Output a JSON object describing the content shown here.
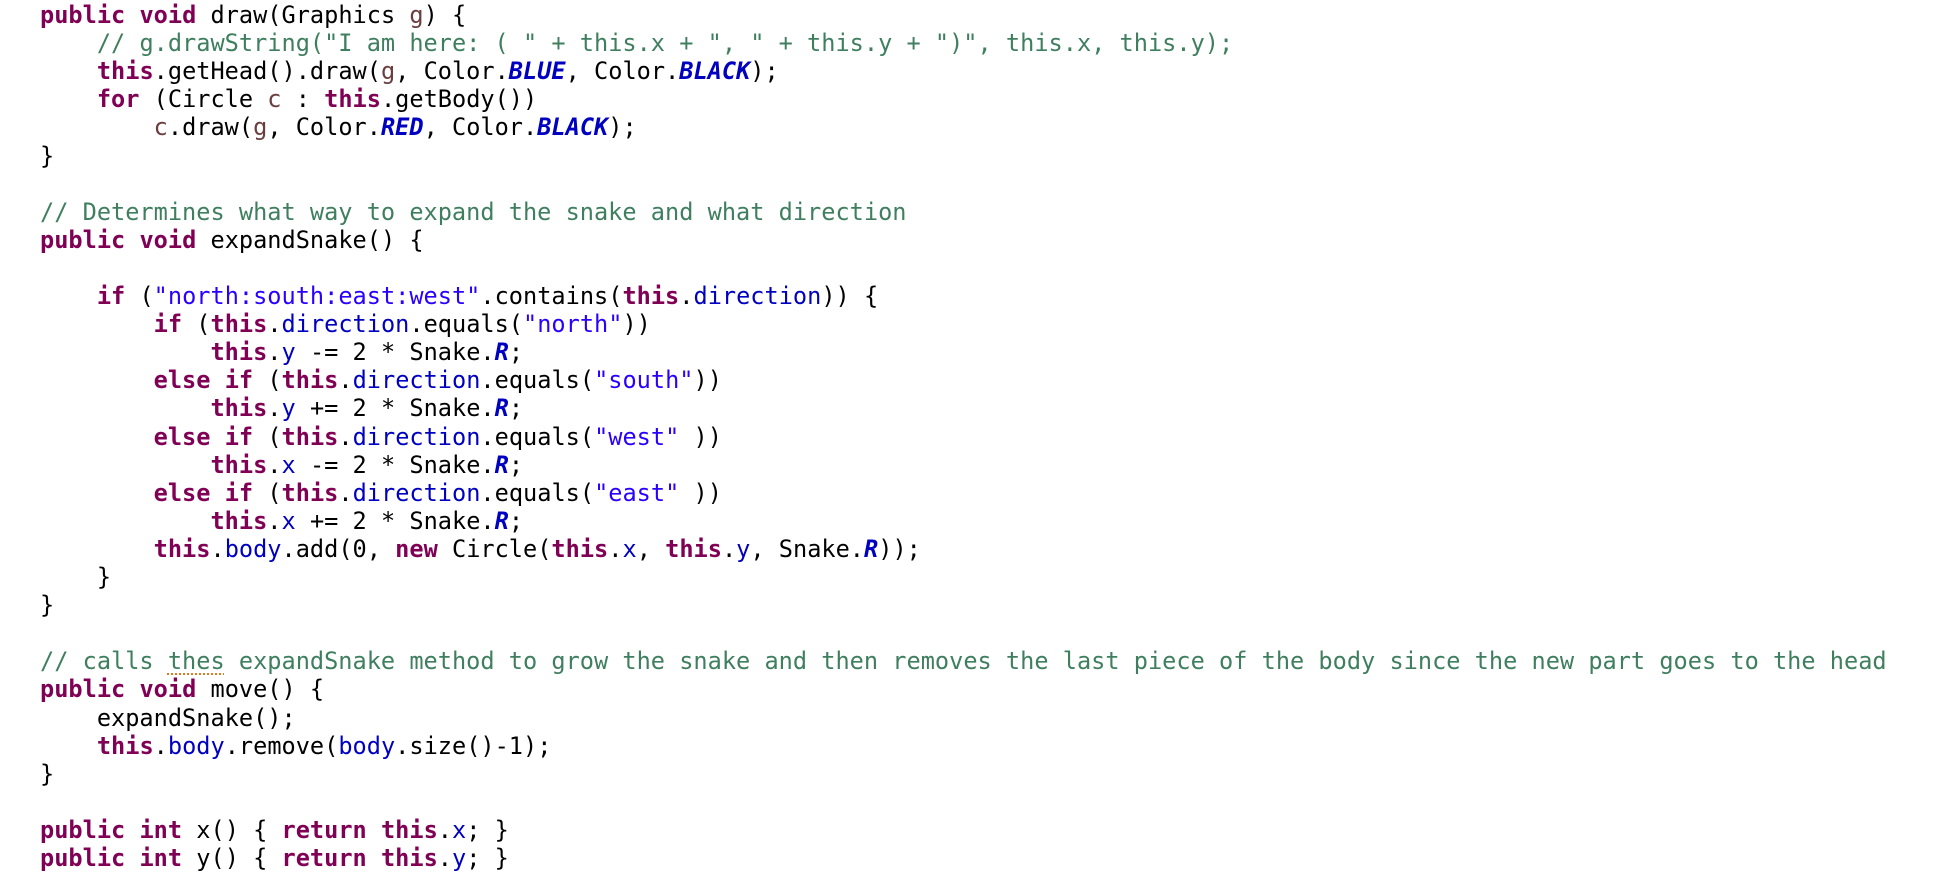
{
  "lines": [
    {
      "tokens": [
        {
          "t": "public",
          "k": "kw"
        },
        {
          "t": " ",
          "k": "pl"
        },
        {
          "t": "void",
          "k": "kw"
        },
        {
          "t": " draw(Graphics ",
          "k": "pl"
        },
        {
          "t": "g",
          "k": "lv"
        },
        {
          "t": ") {",
          "k": "pl"
        }
      ]
    },
    {
      "tokens": [
        {
          "t": "    ",
          "k": "pl"
        },
        {
          "t": "// g.drawString(\"I am here: ( \" + this.x + \", \" + this.y + \")\", this.x, this.y);",
          "k": "cm"
        }
      ]
    },
    {
      "tokens": [
        {
          "t": "    ",
          "k": "pl"
        },
        {
          "t": "this",
          "k": "kw"
        },
        {
          "t": ".getHead().draw(",
          "k": "pl"
        },
        {
          "t": "g",
          "k": "lv"
        },
        {
          "t": ", Color.",
          "k": "pl"
        },
        {
          "t": "BLUE",
          "k": "cs"
        },
        {
          "t": ", Color.",
          "k": "pl"
        },
        {
          "t": "BLACK",
          "k": "cs"
        },
        {
          "t": ");",
          "k": "pl"
        }
      ]
    },
    {
      "tokens": [
        {
          "t": "    ",
          "k": "pl"
        },
        {
          "t": "for",
          "k": "kw"
        },
        {
          "t": " (Circle ",
          "k": "pl"
        },
        {
          "t": "c",
          "k": "lv"
        },
        {
          "t": " : ",
          "k": "pl"
        },
        {
          "t": "this",
          "k": "kw"
        },
        {
          "t": ".getBody())",
          "k": "pl"
        }
      ]
    },
    {
      "tokens": [
        {
          "t": "        ",
          "k": "pl"
        },
        {
          "t": "c",
          "k": "lv"
        },
        {
          "t": ".draw(",
          "k": "pl"
        },
        {
          "t": "g",
          "k": "lv"
        },
        {
          "t": ", Color.",
          "k": "pl"
        },
        {
          "t": "RED",
          "k": "cs"
        },
        {
          "t": ", Color.",
          "k": "pl"
        },
        {
          "t": "BLACK",
          "k": "cs"
        },
        {
          "t": ");",
          "k": "pl"
        }
      ]
    },
    {
      "tokens": [
        {
          "t": "}",
          "k": "pl"
        }
      ]
    },
    {
      "tokens": []
    },
    {
      "tokens": [
        {
          "t": "// Determines what way to expand the snake and what direction",
          "k": "cm"
        }
      ]
    },
    {
      "tokens": [
        {
          "t": "public",
          "k": "kw"
        },
        {
          "t": " ",
          "k": "pl"
        },
        {
          "t": "void",
          "k": "kw"
        },
        {
          "t": " expandSnake() {",
          "k": "pl"
        }
      ]
    },
    {
      "tokens": []
    },
    {
      "tokens": [
        {
          "t": "    ",
          "k": "pl"
        },
        {
          "t": "if",
          "k": "kw"
        },
        {
          "t": " (",
          "k": "pl"
        },
        {
          "t": "\"north:south:east:west\"",
          "k": "st"
        },
        {
          "t": ".contains(",
          "k": "pl"
        },
        {
          "t": "this",
          "k": "kw"
        },
        {
          "t": ".",
          "k": "pl"
        },
        {
          "t": "direction",
          "k": "fd"
        },
        {
          "t": ")) {",
          "k": "pl"
        }
      ]
    },
    {
      "tokens": [
        {
          "t": "        ",
          "k": "pl"
        },
        {
          "t": "if",
          "k": "kw"
        },
        {
          "t": " (",
          "k": "pl"
        },
        {
          "t": "this",
          "k": "kw"
        },
        {
          "t": ".",
          "k": "pl"
        },
        {
          "t": "direction",
          "k": "fd"
        },
        {
          "t": ".equals(",
          "k": "pl"
        },
        {
          "t": "\"north\"",
          "k": "st"
        },
        {
          "t": "))",
          "k": "pl"
        }
      ]
    },
    {
      "tokens": [
        {
          "t": "            ",
          "k": "pl"
        },
        {
          "t": "this",
          "k": "kw"
        },
        {
          "t": ".",
          "k": "pl"
        },
        {
          "t": "y",
          "k": "fd"
        },
        {
          "t": " -= 2 * Snake.",
          "k": "pl"
        },
        {
          "t": "R",
          "k": "cs"
        },
        {
          "t": ";",
          "k": "pl"
        }
      ]
    },
    {
      "tokens": [
        {
          "t": "        ",
          "k": "pl"
        },
        {
          "t": "else",
          "k": "kw"
        },
        {
          "t": " ",
          "k": "pl"
        },
        {
          "t": "if",
          "k": "kw"
        },
        {
          "t": " (",
          "k": "pl"
        },
        {
          "t": "this",
          "k": "kw"
        },
        {
          "t": ".",
          "k": "pl"
        },
        {
          "t": "direction",
          "k": "fd"
        },
        {
          "t": ".equals(",
          "k": "pl"
        },
        {
          "t": "\"south\"",
          "k": "st"
        },
        {
          "t": "))",
          "k": "pl"
        }
      ]
    },
    {
      "tokens": [
        {
          "t": "            ",
          "k": "pl"
        },
        {
          "t": "this",
          "k": "kw"
        },
        {
          "t": ".",
          "k": "pl"
        },
        {
          "t": "y",
          "k": "fd"
        },
        {
          "t": " += 2 * Snake.",
          "k": "pl"
        },
        {
          "t": "R",
          "k": "cs"
        },
        {
          "t": ";",
          "k": "pl"
        }
      ]
    },
    {
      "tokens": [
        {
          "t": "        ",
          "k": "pl"
        },
        {
          "t": "else",
          "k": "kw"
        },
        {
          "t": " ",
          "k": "pl"
        },
        {
          "t": "if",
          "k": "kw"
        },
        {
          "t": " (",
          "k": "pl"
        },
        {
          "t": "this",
          "k": "kw"
        },
        {
          "t": ".",
          "k": "pl"
        },
        {
          "t": "direction",
          "k": "fd"
        },
        {
          "t": ".equals(",
          "k": "pl"
        },
        {
          "t": "\"west\"",
          "k": "st"
        },
        {
          "t": " ))",
          "k": "pl"
        }
      ]
    },
    {
      "tokens": [
        {
          "t": "            ",
          "k": "pl"
        },
        {
          "t": "this",
          "k": "kw"
        },
        {
          "t": ".",
          "k": "pl"
        },
        {
          "t": "x",
          "k": "fd"
        },
        {
          "t": " -= 2 * Snake.",
          "k": "pl"
        },
        {
          "t": "R",
          "k": "cs"
        },
        {
          "t": ";",
          "k": "pl"
        }
      ]
    },
    {
      "tokens": [
        {
          "t": "        ",
          "k": "pl"
        },
        {
          "t": "else",
          "k": "kw"
        },
        {
          "t": " ",
          "k": "pl"
        },
        {
          "t": "if",
          "k": "kw"
        },
        {
          "t": " (",
          "k": "pl"
        },
        {
          "t": "this",
          "k": "kw"
        },
        {
          "t": ".",
          "k": "pl"
        },
        {
          "t": "direction",
          "k": "fd"
        },
        {
          "t": ".equals(",
          "k": "pl"
        },
        {
          "t": "\"east\"",
          "k": "st"
        },
        {
          "t": " ))",
          "k": "pl"
        }
      ]
    },
    {
      "tokens": [
        {
          "t": "            ",
          "k": "pl"
        },
        {
          "t": "this",
          "k": "kw"
        },
        {
          "t": ".",
          "k": "pl"
        },
        {
          "t": "x",
          "k": "fd"
        },
        {
          "t": " += 2 * Snake.",
          "k": "pl"
        },
        {
          "t": "R",
          "k": "cs"
        },
        {
          "t": ";",
          "k": "pl"
        }
      ]
    },
    {
      "tokens": [
        {
          "t": "        ",
          "k": "pl"
        },
        {
          "t": "this",
          "k": "kw"
        },
        {
          "t": ".",
          "k": "pl"
        },
        {
          "t": "body",
          "k": "fd"
        },
        {
          "t": ".add(0, ",
          "k": "pl"
        },
        {
          "t": "new",
          "k": "kw"
        },
        {
          "t": " Circle(",
          "k": "pl"
        },
        {
          "t": "this",
          "k": "kw"
        },
        {
          "t": ".",
          "k": "pl"
        },
        {
          "t": "x",
          "k": "fd"
        },
        {
          "t": ", ",
          "k": "pl"
        },
        {
          "t": "this",
          "k": "kw"
        },
        {
          "t": ".",
          "k": "pl"
        },
        {
          "t": "y",
          "k": "fd"
        },
        {
          "t": ", Snake.",
          "k": "pl"
        },
        {
          "t": "R",
          "k": "cs"
        },
        {
          "t": "));",
          "k": "pl"
        }
      ]
    },
    {
      "tokens": [
        {
          "t": "    }",
          "k": "pl"
        }
      ]
    },
    {
      "tokens": [
        {
          "t": "}",
          "k": "pl"
        }
      ]
    },
    {
      "tokens": []
    },
    {
      "tokens": [
        {
          "t": "// calls ",
          "k": "cm"
        },
        {
          "t": "thes",
          "k": "sp"
        },
        {
          "t": " expandSnake method to grow the snake and then removes the last piece of the body since the new part goes to the head",
          "k": "cm"
        }
      ]
    },
    {
      "tokens": [
        {
          "t": "public",
          "k": "kw"
        },
        {
          "t": " ",
          "k": "pl"
        },
        {
          "t": "void",
          "k": "kw"
        },
        {
          "t": " move() {",
          "k": "pl"
        }
      ]
    },
    {
      "tokens": [
        {
          "t": "    expandSnake();",
          "k": "pl"
        }
      ]
    },
    {
      "tokens": [
        {
          "t": "    ",
          "k": "pl"
        },
        {
          "t": "this",
          "k": "kw"
        },
        {
          "t": ".",
          "k": "pl"
        },
        {
          "t": "body",
          "k": "fd"
        },
        {
          "t": ".remove(",
          "k": "pl"
        },
        {
          "t": "body",
          "k": "fd"
        },
        {
          "t": ".size()-1);",
          "k": "pl"
        }
      ]
    },
    {
      "tokens": [
        {
          "t": "}",
          "k": "pl"
        }
      ]
    },
    {
      "tokens": []
    },
    {
      "tokens": [
        {
          "t": "public",
          "k": "kw"
        },
        {
          "t": " ",
          "k": "pl"
        },
        {
          "t": "int",
          "k": "kw"
        },
        {
          "t": " x() { ",
          "k": "pl"
        },
        {
          "t": "return",
          "k": "kw"
        },
        {
          "t": " ",
          "k": "pl"
        },
        {
          "t": "this",
          "k": "kw"
        },
        {
          "t": ".",
          "k": "pl"
        },
        {
          "t": "x",
          "k": "fd"
        },
        {
          "t": "; }",
          "k": "pl"
        }
      ]
    },
    {
      "tokens": [
        {
          "t": "public",
          "k": "kw"
        },
        {
          "t": " ",
          "k": "pl"
        },
        {
          "t": "int",
          "k": "kw"
        },
        {
          "t": " y() { ",
          "k": "pl"
        },
        {
          "t": "return",
          "k": "kw"
        },
        {
          "t": " ",
          "k": "pl"
        },
        {
          "t": "this",
          "k": "kw"
        },
        {
          "t": ".",
          "k": "pl"
        },
        {
          "t": "y",
          "k": "fd"
        },
        {
          "t": "; }",
          "k": "pl"
        }
      ]
    }
  ]
}
